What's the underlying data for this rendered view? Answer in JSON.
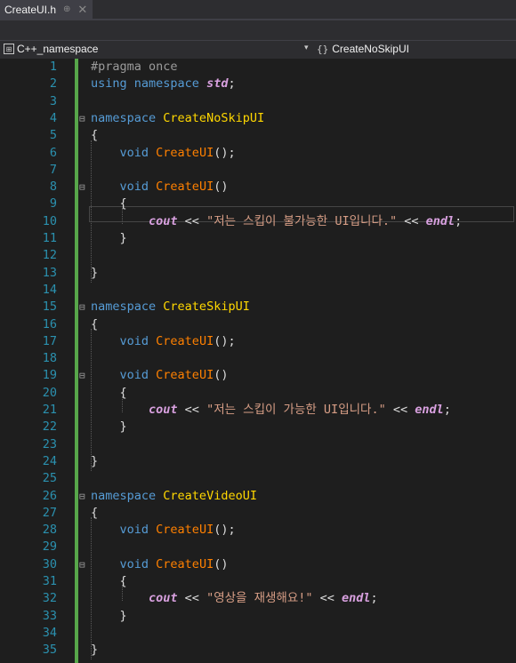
{
  "tab": {
    "title": "CreateUI.h",
    "pin": "⊕",
    "close": "✕"
  },
  "navbar": {
    "left_icon": "class-icon",
    "scope": "C++_namespace",
    "dropdown": "▾",
    "right_braces": "{}",
    "member": "CreateNoSkipUI"
  },
  "colors": {
    "keyword": "#569cd6",
    "namespace_name": "#ffd700",
    "function": "#ff8000",
    "variable": "#d8a0df",
    "string": "#d69d85",
    "line_number": "#2b91af",
    "change_bar": "#57a64a"
  },
  "code": {
    "lines": [
      {
        "n": "1",
        "fold": "",
        "tokens": [
          [
            "pp",
            "#pragma once"
          ]
        ]
      },
      {
        "n": "2",
        "fold": "",
        "tokens": [
          [
            "kw",
            "using"
          ],
          [
            "plain",
            " "
          ],
          [
            "kw",
            "namespace"
          ],
          [
            "plain",
            " "
          ],
          [
            "var",
            "std"
          ],
          [
            "plain",
            ";"
          ]
        ]
      },
      {
        "n": "3",
        "fold": "",
        "tokens": []
      },
      {
        "n": "4",
        "fold": "⊟",
        "tokens": [
          [
            "kw",
            "namespace"
          ],
          [
            "plain",
            " "
          ],
          [
            "nsname",
            "CreateNoSkipUI"
          ]
        ]
      },
      {
        "n": "5",
        "fold": "",
        "tokens": [
          [
            "plain",
            "{"
          ]
        ]
      },
      {
        "n": "6",
        "fold": "",
        "tokens": [
          [
            "plain",
            "    "
          ],
          [
            "kw",
            "void"
          ],
          [
            "plain",
            " "
          ],
          [
            "fn",
            "CreateUI"
          ],
          [
            "plain",
            "();"
          ]
        ]
      },
      {
        "n": "7",
        "fold": "",
        "tokens": []
      },
      {
        "n": "8",
        "fold": "⊟",
        "tokens": [
          [
            "plain",
            "    "
          ],
          [
            "kw",
            "void"
          ],
          [
            "plain",
            " "
          ],
          [
            "fn",
            "CreateUI"
          ],
          [
            "plain",
            "()"
          ]
        ]
      },
      {
        "n": "9",
        "fold": "",
        "tokens": [
          [
            "plain",
            "    {"
          ]
        ]
      },
      {
        "n": "10",
        "fold": "",
        "tokens": [
          [
            "plain",
            "        "
          ],
          [
            "var",
            "cout"
          ],
          [
            "plain",
            " << "
          ],
          [
            "str",
            "\"저는 스킵이 불가능한 UI입니다.\""
          ],
          [
            "plain",
            " << "
          ],
          [
            "var",
            "endl"
          ],
          [
            "plain",
            ";"
          ]
        ]
      },
      {
        "n": "11",
        "fold": "",
        "tokens": [
          [
            "plain",
            "    }"
          ]
        ]
      },
      {
        "n": "12",
        "fold": "",
        "tokens": []
      },
      {
        "n": "13",
        "fold": "",
        "tokens": [
          [
            "plain",
            "}"
          ]
        ]
      },
      {
        "n": "14",
        "fold": "",
        "tokens": []
      },
      {
        "n": "15",
        "fold": "⊟",
        "tokens": [
          [
            "kw",
            "namespace"
          ],
          [
            "plain",
            " "
          ],
          [
            "nsname",
            "CreateSkipUI"
          ]
        ]
      },
      {
        "n": "16",
        "fold": "",
        "tokens": [
          [
            "plain",
            "{"
          ]
        ]
      },
      {
        "n": "17",
        "fold": "",
        "tokens": [
          [
            "plain",
            "    "
          ],
          [
            "kw",
            "void"
          ],
          [
            "plain",
            " "
          ],
          [
            "fn",
            "CreateUI"
          ],
          [
            "plain",
            "();"
          ]
        ]
      },
      {
        "n": "18",
        "fold": "",
        "tokens": []
      },
      {
        "n": "19",
        "fold": "⊟",
        "tokens": [
          [
            "plain",
            "    "
          ],
          [
            "kw",
            "void"
          ],
          [
            "plain",
            " "
          ],
          [
            "fn",
            "CreateUI"
          ],
          [
            "plain",
            "()"
          ]
        ]
      },
      {
        "n": "20",
        "fold": "",
        "tokens": [
          [
            "plain",
            "    {"
          ]
        ]
      },
      {
        "n": "21",
        "fold": "",
        "tokens": [
          [
            "plain",
            "        "
          ],
          [
            "var",
            "cout"
          ],
          [
            "plain",
            " << "
          ],
          [
            "str",
            "\"저는 스킵이 가능한 UI입니다.\""
          ],
          [
            "plain",
            " << "
          ],
          [
            "var",
            "endl"
          ],
          [
            "plain",
            ";"
          ]
        ]
      },
      {
        "n": "22",
        "fold": "",
        "tokens": [
          [
            "plain",
            "    }"
          ]
        ]
      },
      {
        "n": "23",
        "fold": "",
        "tokens": []
      },
      {
        "n": "24",
        "fold": "",
        "tokens": [
          [
            "plain",
            "}"
          ]
        ]
      },
      {
        "n": "25",
        "fold": "",
        "tokens": []
      },
      {
        "n": "26",
        "fold": "⊟",
        "tokens": [
          [
            "kw",
            "namespace"
          ],
          [
            "plain",
            " "
          ],
          [
            "nsname",
            "CreateVideoUI"
          ]
        ]
      },
      {
        "n": "27",
        "fold": "",
        "tokens": [
          [
            "plain",
            "{"
          ]
        ]
      },
      {
        "n": "28",
        "fold": "",
        "tokens": [
          [
            "plain",
            "    "
          ],
          [
            "kw",
            "void"
          ],
          [
            "plain",
            " "
          ],
          [
            "fn",
            "CreateUI"
          ],
          [
            "plain",
            "();"
          ]
        ]
      },
      {
        "n": "29",
        "fold": "",
        "tokens": []
      },
      {
        "n": "30",
        "fold": "⊟",
        "tokens": [
          [
            "plain",
            "    "
          ],
          [
            "kw",
            "void"
          ],
          [
            "plain",
            " "
          ],
          [
            "fn",
            "CreateUI"
          ],
          [
            "plain",
            "()"
          ]
        ]
      },
      {
        "n": "31",
        "fold": "",
        "tokens": [
          [
            "plain",
            "    {"
          ]
        ]
      },
      {
        "n": "32",
        "fold": "",
        "tokens": [
          [
            "plain",
            "        "
          ],
          [
            "var",
            "cout"
          ],
          [
            "plain",
            " << "
          ],
          [
            "str",
            "\"영상을 재생해요!\""
          ],
          [
            "plain",
            " << "
          ],
          [
            "var",
            "endl"
          ],
          [
            "plain",
            ";"
          ]
        ]
      },
      {
        "n": "33",
        "fold": "",
        "tokens": [
          [
            "plain",
            "    }"
          ]
        ]
      },
      {
        "n": "34",
        "fold": "",
        "tokens": []
      },
      {
        "n": "35",
        "fold": "",
        "tokens": [
          [
            "plain",
            "}"
          ]
        ]
      }
    ]
  }
}
